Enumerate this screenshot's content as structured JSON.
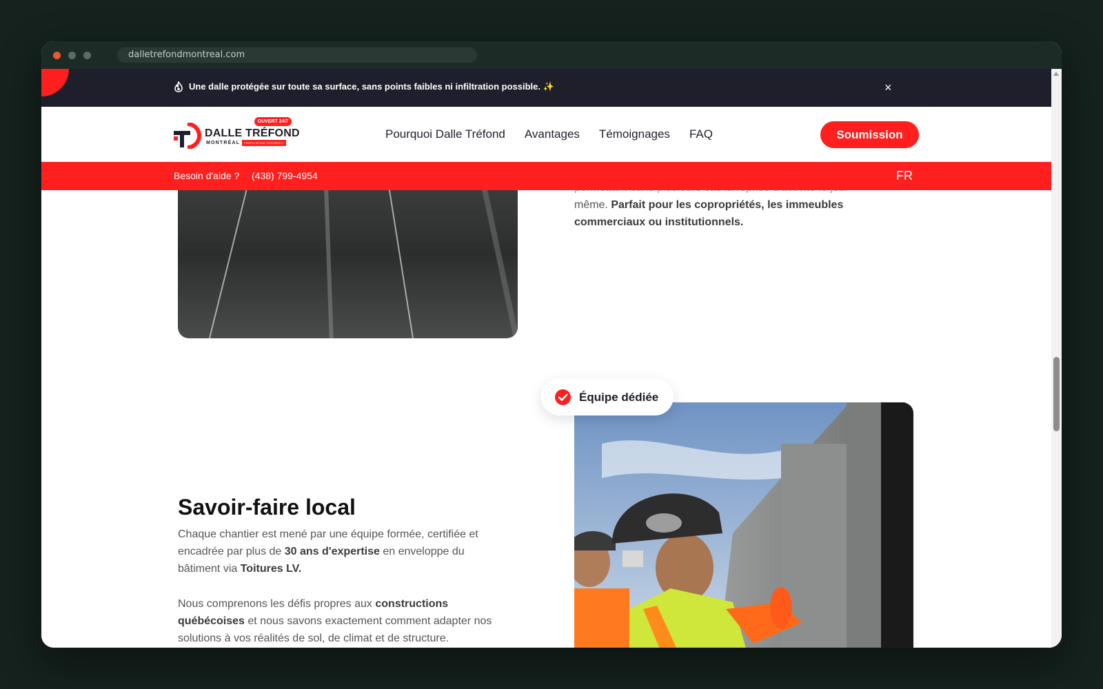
{
  "browser": {
    "url": "dalletrefondmontreal.com"
  },
  "promo": {
    "text": "Une dalle protégée sur toute sa surface, sans points faibles ni infiltration possible. ✨",
    "close_label": "×"
  },
  "logo": {
    "title": "DALLE TRÉFOND",
    "subtitle": "MONTRÉAL",
    "tagline": "PROPULSÉ PAR TOITURES LV",
    "badge": "OUVERT 24/7"
  },
  "nav": {
    "items": [
      {
        "label": "Pourquoi Dalle Tréfond"
      },
      {
        "label": "Avantages"
      },
      {
        "label": "Témoignages"
      },
      {
        "label": "FAQ"
      }
    ],
    "cta_label": "Soumission"
  },
  "help_bar": {
    "label": "Besoin d'aide ?",
    "phone": "(438) 799-4954",
    "language": "FR"
  },
  "section1": {
    "cut_line": "permettant dans plusieurs cas la reprise d'activité le jour",
    "line_start": "même. ",
    "line_bold": "Parfait pour les copropriétés, les immeubles commerciaux ou institutionnels."
  },
  "section2": {
    "badge": "Équipe dédiée",
    "title": "Savoir-faire local",
    "p1_a": "Chaque chantier est mené par une équipe formée, certifiée et encadrée par plus de ",
    "p1_b": "30 ans d'expertise",
    "p1_c": " en enveloppe du bâtiment via ",
    "p1_d": "Toitures LV.",
    "p2_a": "Nous comprenons les défis propres aux ",
    "p2_b": "constructions québécoises",
    "p2_c": " et nous savons exactement comment adapter nos solutions à vos réalités de sol, de climat et de structure."
  },
  "colors": {
    "accent": "#ff1f1f",
    "dark": "#1f1f2b",
    "body_text": "#555555"
  }
}
